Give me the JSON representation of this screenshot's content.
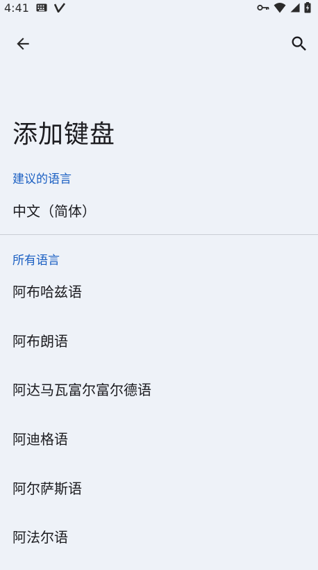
{
  "status_bar": {
    "time": "4:41",
    "icons": [
      "keyboard-icon",
      "v-icon",
      "key-icon",
      "wifi-icon",
      "signal-icon",
      "battery-icon"
    ]
  },
  "app_bar": {
    "back_icon": "arrow-back-icon",
    "search_icon": "search-icon"
  },
  "page": {
    "title": "添加键盘"
  },
  "suggested": {
    "header": "建议的语言",
    "items": [
      {
        "label": "中文（简体）"
      }
    ]
  },
  "all_languages": {
    "header": "所有语言",
    "items": [
      {
        "label": "阿布哈兹语"
      },
      {
        "label": "阿布朗语"
      },
      {
        "label": "阿达马瓦富尔富尔德语"
      },
      {
        "label": "阿迪格语"
      },
      {
        "label": "阿尔萨斯语"
      },
      {
        "label": "阿法尔语"
      }
    ]
  },
  "colors": {
    "background": "#eef2f8",
    "accent": "#1a5fc2",
    "text": "#1b1b1f"
  }
}
